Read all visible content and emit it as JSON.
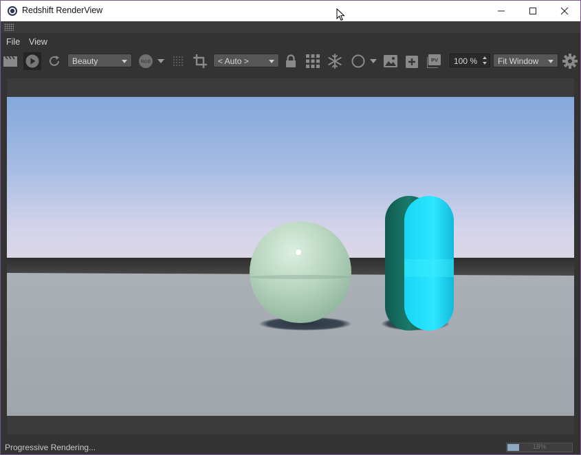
{
  "window": {
    "title": "Redshift RenderView",
    "minimize_icon": "minimize-icon",
    "maximize_icon": "maximize-icon",
    "close_icon": "close-icon"
  },
  "menu": {
    "items": [
      {
        "label": "File"
      },
      {
        "label": "View"
      }
    ]
  },
  "toolbar": {
    "aov_value": "Beauty",
    "rgb_label": "RGB",
    "camera_value": "< Auto >",
    "pv_label": "PV",
    "zoom_value": "100 %",
    "fit_value": "Fit Window",
    "icons": [
      "clapper-icon",
      "play-icon",
      "refresh-icon",
      "rgb-icon",
      "dotted-grid-icon",
      "crop-icon",
      "lock-icon",
      "grid-icon",
      "snowflake-icon",
      "circle-icon",
      "image-icon",
      "add-image-icon",
      "pv-icon",
      "gear-icon"
    ]
  },
  "status": {
    "text": "Progressive Rendering...",
    "progress_percent_label": "18%",
    "progress_fraction": 0.18
  },
  "colors": {
    "background": "#333333",
    "accent_progress": "#8ea8c4",
    "capsule": "#1fe0ff",
    "sphere": "#b9d6bf"
  }
}
